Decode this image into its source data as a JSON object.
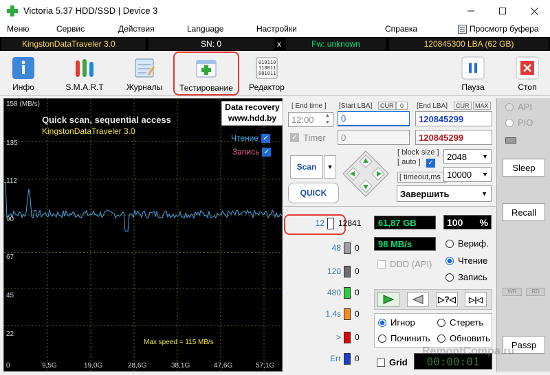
{
  "window": {
    "title": "Victoria 5.37 HDD/SSD | Device 3"
  },
  "menu": {
    "items": [
      "Меню",
      "Сервис",
      "Действия",
      "Language",
      "Настройки",
      "Справка"
    ],
    "buffer_view": "Просмотр буфера"
  },
  "strip": {
    "device": "KingstonDataTraveler 3.0",
    "sn": "SN: 0",
    "close": "x",
    "fw": "Fw: unknown",
    "lba": "120845300 LBA (62 GB)"
  },
  "toolbar": {
    "info": "Инфо",
    "smart": "S.M.A.R.T",
    "logs": "Журналы",
    "testing": "Тестирование",
    "editor": "Редактор",
    "pause": "Пауза",
    "stop": "Стоп"
  },
  "graph": {
    "unit": "158 (MB/s)",
    "heading1": "Quick scan, sequential access",
    "heading2": "KingstonDataTraveler 3.0",
    "recovery1": "Data recovery",
    "recovery2": "www.hdd.by",
    "read_label": "Чтение",
    "write_label": "Запись",
    "max_speed": "Max speed = 115 MB/s",
    "y_ticks": [
      "135",
      "112",
      "90",
      "67",
      "45",
      "22"
    ],
    "x_ticks": [
      "0",
      "9,5G",
      "19,0G",
      "28,6G",
      "38,1G",
      "47,6G",
      "57,1G"
    ],
    "colors": {
      "line": "#4aa3e8",
      "grid": "#5b6b1f",
      "bg": "#000000"
    }
  },
  "params": {
    "end_time_label": "[ End time ]",
    "start_lba_label": "[Start LBA]",
    "cur": "CUR",
    "cur_val": "0",
    "end_lba_label": "[End LBA]",
    "cur2": "CUR",
    "max": "MAX",
    "time_value": "12:00",
    "start_lba_value": "0",
    "end_lba_value": "120845299",
    "timer_label": "Timer",
    "timer_value": "0",
    "end_lba_value2": "120845299",
    "block_size_label": "[ block size ]",
    "auto_label": "[ auto ]",
    "block_size_value": "2048",
    "timeout_label": "[ timeout,ms ]",
    "timeout_value": "10000",
    "scan_btn": "Scan",
    "quick_btn": "QUICK",
    "finish_select": "Завершить"
  },
  "blocks": [
    {
      "name": "12",
      "count": "12841",
      "color": "#ffffff"
    },
    {
      "name": "48",
      "count": "0",
      "color": "#9e9e9e"
    },
    {
      "name": "120",
      "count": "0",
      "color": "#6d6d6d"
    },
    {
      "name": "480",
      "count": "0",
      "color": "#2ecc40"
    },
    {
      "name": "1,4s",
      "count": "0",
      "color": "#ff8c1a"
    },
    {
      "name": ">",
      "count": "0",
      "color": "#e00000"
    },
    {
      "name": "Err",
      "count": "0",
      "color": "#1a3fcc"
    }
  ],
  "stats": {
    "size": "61,87 GB",
    "percent": "100",
    "percent_unit": "%",
    "speed": "98 MB/s",
    "ddd": "DDD (API)",
    "verify": "Вериф.",
    "read": "Чтение",
    "write": "Запись"
  },
  "actions": {
    "ignore": "Игнор",
    "erase": "Стереть",
    "fix": "Починить",
    "refresh": "Обновить",
    "grid": "Grid",
    "timer": "00:00:01"
  },
  "right": {
    "api": "API",
    "pio": "PIO",
    "sleep": "Sleep",
    "recall": "Recall",
    "wr": "WR",
    "rd": "RD",
    "passp": "Passp"
  },
  "watermark": "RemontCompa.ru"
}
